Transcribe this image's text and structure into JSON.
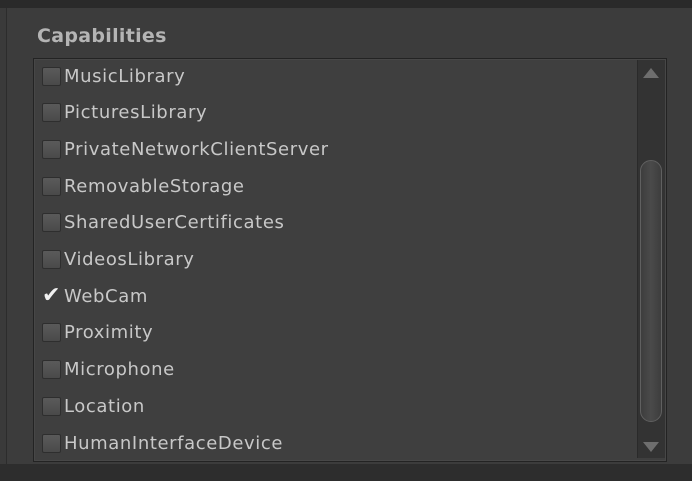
{
  "section": {
    "title": "Capabilities"
  },
  "capabilities": [
    {
      "label": "MusicLibrary",
      "checked": false
    },
    {
      "label": "PicturesLibrary",
      "checked": false
    },
    {
      "label": "PrivateNetworkClientServer",
      "checked": false
    },
    {
      "label": "RemovableStorage",
      "checked": false
    },
    {
      "label": "SharedUserCertificates",
      "checked": false
    },
    {
      "label": "VideosLibrary",
      "checked": false
    },
    {
      "label": "WebCam",
      "checked": true
    },
    {
      "label": "Proximity",
      "checked": false
    },
    {
      "label": "Microphone",
      "checked": false
    },
    {
      "label": "Location",
      "checked": false
    },
    {
      "label": "HumanInterfaceDevice",
      "checked": false
    }
  ],
  "checkmark_glyph": "✔",
  "icons": {
    "scroll_up": "scroll-up-arrow-icon",
    "scroll_down": "scroll-down-arrow-icon",
    "check": "checkmark-icon"
  },
  "colors": {
    "background": "#3a3a3a",
    "title": "#b4b4b4",
    "label": "#c8c8c8",
    "checkmark": "#f0f0f0"
  }
}
